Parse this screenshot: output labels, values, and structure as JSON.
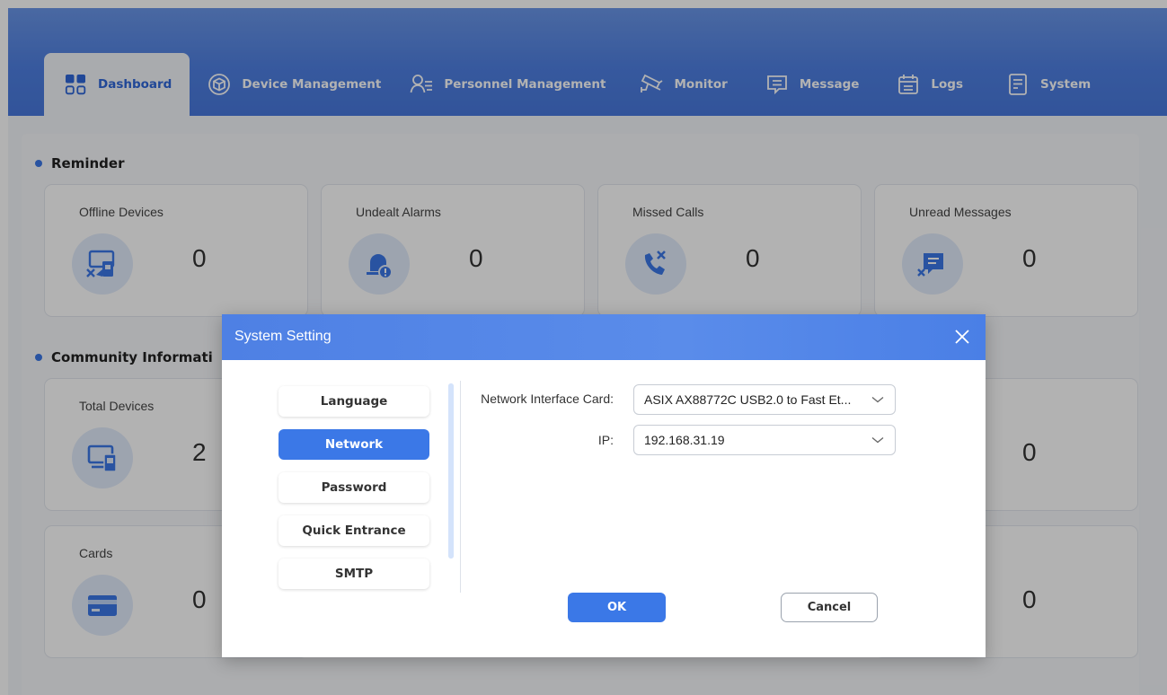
{
  "nav": {
    "tabs": [
      {
        "label": "Dashboard",
        "icon": "grid-icon",
        "active": true
      },
      {
        "label": "Device Management",
        "icon": "cube-icon"
      },
      {
        "label": "Personnel Management",
        "icon": "person-list-icon"
      },
      {
        "label": "Monitor",
        "icon": "camera-icon"
      },
      {
        "label": "Message",
        "icon": "message-icon"
      },
      {
        "label": "Logs",
        "icon": "calendar-icon"
      },
      {
        "label": "System",
        "icon": "document-icon"
      }
    ]
  },
  "dashboard": {
    "reminder": {
      "title": "Reminder",
      "cards": [
        {
          "label": "Offline Devices",
          "value": "0",
          "icon": "offline-device-icon"
        },
        {
          "label": "Undealt Alarms",
          "value": "0",
          "icon": "alarm-icon"
        },
        {
          "label": "Missed Calls",
          "value": "0",
          "icon": "missed-call-icon"
        },
        {
          "label": "Unread Messages",
          "value": "0",
          "icon": "unread-message-icon"
        }
      ]
    },
    "community": {
      "title": "Community Informati",
      "cards": [
        {
          "label": "Total Devices",
          "value": "2",
          "icon": "devices-icon"
        },
        {
          "label": "",
          "value": "0"
        },
        {
          "label": "Cards",
          "value": "0",
          "icon": "card-icon"
        },
        {
          "label": "",
          "value": "0"
        }
      ]
    }
  },
  "dialog": {
    "title": "System Setting",
    "menu": [
      {
        "label": "Language"
      },
      {
        "label": "Network",
        "active": true
      },
      {
        "label": "Password"
      },
      {
        "label": "Quick Entrance"
      },
      {
        "label": "SMTP"
      }
    ],
    "form": {
      "nic_label": "Network Interface Card:",
      "nic_value": "ASIX AX88772C USB2.0 to Fast Et...",
      "ip_label": "IP:",
      "ip_value": "192.168.31.19"
    },
    "ok_label": "OK",
    "cancel_label": "Cancel"
  },
  "colors": {
    "accent": "#3b78e7",
    "header": "#4f80e2",
    "icon_bg": "#e1ebfb",
    "panel_bg": "#f3f5f9"
  }
}
